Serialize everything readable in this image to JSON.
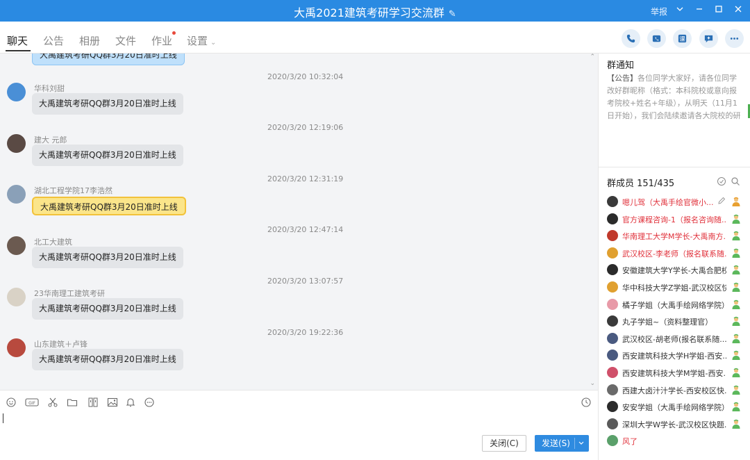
{
  "window": {
    "title": "大禹2021建筑考研学习交流群",
    "report_label": "举报"
  },
  "tabs": [
    {
      "label": "聊天"
    },
    {
      "label": "公告"
    },
    {
      "label": "相册"
    },
    {
      "label": "文件"
    },
    {
      "label": "作业"
    },
    {
      "label": "设置"
    }
  ],
  "chat": {
    "top_partial_message": "大禹建筑考研QQ群3月20日准时上线",
    "messages": [
      {
        "time": "2020/3/20 10:32:04",
        "sender": "华科刘甜",
        "text": "大禹建筑考研QQ群3月20日准时上线",
        "avatar_color": "#4a8fd6"
      },
      {
        "time": "2020/3/20 12:19:06",
        "sender": "建大    元郎",
        "text": "大禹建筑考研QQ群3月20日准时上线",
        "avatar_color": "#5a4a44"
      },
      {
        "time": "2020/3/20 12:31:19",
        "sender": "湖北工程学院17李浩然",
        "text": "大禹建筑考研QQ群3月20日准时上线",
        "avatar_color": "#8aa0b8"
      },
      {
        "time": "2020/3/20 12:47:14",
        "sender": "北工大建筑",
        "text": "大禹建筑考研QQ群3月20日准时上线",
        "avatar_color": "#6b5a50"
      },
      {
        "time": "2020/3/20 13:07:57",
        "sender": "23华南理工建筑考研",
        "text": "大禹建筑考研QQ群3月20日准时上线",
        "avatar_color": "#d9d2c6"
      },
      {
        "time": "2020/3/20 19:22:36",
        "sender": "山东建筑＋卢锋",
        "text": "大禹建筑考研QQ群3月20日准时上线",
        "avatar_color": "#b84a3e"
      }
    ]
  },
  "composer": {
    "close_label": "关闭(C)",
    "send_label": "发送(S)"
  },
  "notice": {
    "title": "群通知",
    "tag": "【公告】",
    "body": "各位同学大家好，请各位同学改好群昵称（格式：本科院校或意向报考院校+姓名+年级），从明天（11月1日开始），我们会陆续邀请各大院校的研究..."
  },
  "members": {
    "title": "群成员 151/435",
    "list": [
      {
        "name": "嗯儿驾（大禹手绘官微小...",
        "red": true,
        "avatar_color": "#3a3a3a",
        "badge": "owner"
      },
      {
        "name": "官方课程咨询-1（报名咨询随...",
        "red": true,
        "avatar_color": "#2b2b2b",
        "badge": "admin"
      },
      {
        "name": "华南理工大学M学长-大禹南方...",
        "red": true,
        "avatar_color": "#c0392b",
        "badge": "admin"
      },
      {
        "name": "武汉校区-李老师（报名联系随...",
        "red": true,
        "avatar_color": "#e0a030",
        "badge": "admin"
      },
      {
        "name": "安徽建筑大学Y学长-大禹合肥校...",
        "red": false,
        "avatar_color": "#2b2b2b",
        "badge": "admin"
      },
      {
        "name": "华中科技大学Z学姐-武汉校区快...",
        "red": false,
        "avatar_color": "#e0a030",
        "badge": "admin"
      },
      {
        "name": "橘子学姐（大禹手绘网络学院）",
        "red": false,
        "avatar_color": "#e89aa8",
        "badge": "admin"
      },
      {
        "name": "丸子学姐~（资料整理官）",
        "red": false,
        "avatar_color": "#3a3a3a",
        "badge": "admin"
      },
      {
        "name": "武汉校区-胡老师(报名联系随...",
        "red": false,
        "avatar_color": "#4a5a80",
        "badge": "admin"
      },
      {
        "name": "西安建筑科技大学H学姐-西安...",
        "red": false,
        "avatar_color": "#4a5a80",
        "badge": "admin"
      },
      {
        "name": "西安建筑科技大学M学姐-西安...",
        "red": false,
        "avatar_color": "#d0506a",
        "badge": "admin"
      },
      {
        "name": "西建大卤汁汁学长-西安校区快...",
        "red": false,
        "avatar_color": "#6a6a6a",
        "badge": "admin"
      },
      {
        "name": "安安学姐（大禹手绘网络学院）",
        "red": false,
        "avatar_color": "#2b2b2b",
        "badge": "admin"
      },
      {
        "name": "深圳大学W学长-武汉校区快题...",
        "red": false,
        "avatar_color": "#5a5a5a",
        "badge": "admin"
      },
      {
        "name": "风了",
        "red": true,
        "avatar_color": "#5aa06a",
        "badge": "none"
      }
    ]
  },
  "colors": {
    "titlebar": "#2a8ae2",
    "send_button": "#2f8be0",
    "highlight_bubble": "#fbe58a",
    "red_name": "#e0303a"
  }
}
